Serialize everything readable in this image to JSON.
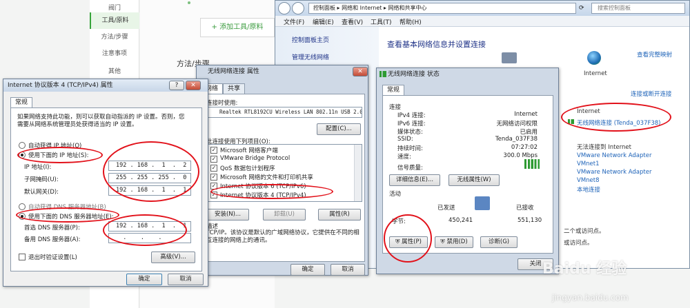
{
  "background_page": {
    "nav_items": [
      "阀门",
      "工具/原料",
      "方法/步骤",
      "注意事项",
      "其他"
    ],
    "add_tool_button": "+ 添加工具/原料",
    "step_heading": "方法/步骤"
  },
  "explorer": {
    "address_parts": [
      "控制面板",
      "网络和 Internet",
      "网络和共享中心"
    ],
    "search_placeholder": "搜索控制面板",
    "menus": [
      "文件(F)",
      "编辑(E)",
      "查看(V)",
      "工具(T)",
      "帮助(H)"
    ],
    "left_links": [
      "控制面板主页",
      "管理无线网络"
    ],
    "heading": "查看基本网络信息并设置连接",
    "full_map_link": "查看完整映射",
    "internet_label": "Internet",
    "connect_disconnect_link": "连接或断开连接",
    "access_type_label": "Internet",
    "wireless_link": "无线网络连接 (Tenda_037F38)",
    "no_internet_label": "无法连接到 Internet",
    "adapters": [
      "VMware Network Adapter",
      "VMnet1",
      "VMware Network Adapter",
      "VMnet8",
      "本地连接"
    ],
    "partial_right_text": [
      "二个或访问点。",
      "或访问点。"
    ]
  },
  "status_dialog": {
    "title": "无线网络连接 状态",
    "tab": "常规",
    "section_connection": "连接",
    "rows": [
      {
        "label": "IPv4 连接:",
        "value": "Internet"
      },
      {
        "label": "IPv6 连接:",
        "value": "无网络访问权限"
      },
      {
        "label": "媒体状态:",
        "value": "已启用"
      },
      {
        "label": "SSID:",
        "value": "Tenda_037F38"
      },
      {
        "label": "持续时间:",
        "value": "07:27:02"
      },
      {
        "label": "速度:",
        "value": "300.0 Mbps"
      }
    ],
    "signal_label": "信号质量:",
    "details_button": "详细信息(E)...",
    "wireless_props_button": "无线属性(W)",
    "section_activity": "活动",
    "sent_label": "已发送",
    "received_label": "已接收",
    "bytes_label": "字节:",
    "bytes_sent": "450,241",
    "bytes_received": "551,130",
    "properties_button": "属性(P)",
    "disable_button": "禁用(D)",
    "diagnose_button": "诊断(G)",
    "close_button": "关闭"
  },
  "props_dialog": {
    "title": "无线网络连接 属性",
    "tabs": [
      "网络",
      "共享"
    ],
    "connect_using_label": "连接时使用:",
    "adapter_name": "Realtek RTL8192CU Wireless LAN 802.11n USB 2.0",
    "configure_button": "配置(C)...",
    "items_label": "此连接使用下列项目(O):",
    "items": [
      "Microsoft 网络客户端",
      "VMware Bridge Protocol",
      "QoS 数据包计划程序",
      "Microsoft 网络的文件和打印机共享",
      "Internet 协议版本 6 (TCP/IPv6)",
      "Internet 协议版本 4 (TCP/IPv4)"
    ],
    "install_button": "安装(N)...",
    "uninstall_button": "卸载(U)",
    "properties_button": "属性(R)",
    "description_label": "描述",
    "description_text": "TCP/IP。该协议是默认的广域网络协议，它提供在不同的相互连接的网络上的通讯。",
    "ok_button": "确定",
    "cancel_button": "取消"
  },
  "ipv4_dialog": {
    "title": "Internet 协议版本 4 (TCP/IPv4) 属性",
    "tab": "常规",
    "intro": "如果网络支持此功能，则可以获取自动指派的 IP 设置。否则，您需要从网络系统管理员处获得适当的 IP 设置。",
    "auto_ip_label": "自动获得 IP 地址(O)",
    "manual_ip_label": "使用下面的 IP 地址(S):",
    "ip_label": "IP 地址(I):",
    "ip_value": "192 . 168 .  1  .  2",
    "subnet_label": "子网掩码(U):",
    "subnet_value": "255 . 255 . 255 .  0",
    "gateway_label": "默认网关(D):",
    "gateway_value": "192 . 168 .  1  .  1",
    "auto_dns_label": "自动获得 DNS 服务器地址(B)",
    "manual_dns_label": "使用下面的 DNS 服务器地址(E):",
    "preferred_dns_label": "首选 DNS 服务器(P):",
    "preferred_dns_value": "192 . 168 .  1  .  1",
    "alternate_dns_label": "备用 DNS 服务器(A):",
    "alternate_dns_value": "  .    .    .",
    "validate_label": "退出时验证设置(L)",
    "advanced_button": "高级(V)...",
    "ok_button": "确定",
    "cancel_button": "取消"
  },
  "watermark": {
    "line1": "Baidu 经验",
    "line2": "jingyan.baidu.com"
  }
}
